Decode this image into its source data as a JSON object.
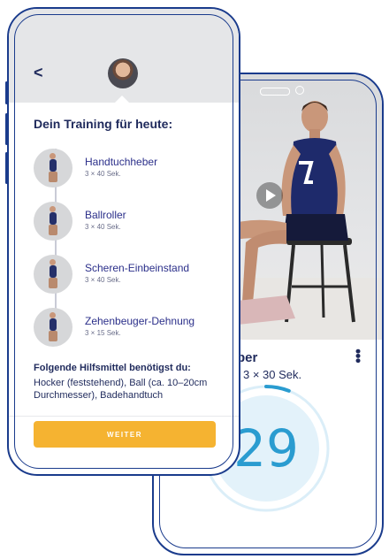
{
  "plan": {
    "title": "Dein Training für heute:",
    "exercises": [
      {
        "name": "Handtuchheber",
        "sets": "3 × 40 Sek."
      },
      {
        "name": "Ballroller",
        "sets": "3 × 40 Sek."
      },
      {
        "name": "Scheren-Einbeinstand",
        "sets": "3 × 40 Sek."
      },
      {
        "name": "Zehenbeuger-Dehnung",
        "sets": "3 × 15 Sek."
      }
    ],
    "aids_title": "Folgende Hilfsmittel benötigst du:",
    "aids_text": "Hocker (feststehend), Ball (ca. 10–20cm Durchmesser), Badehandtuch",
    "cta_label": "WEITER"
  },
  "player": {
    "exercise_title": "ber",
    "exercise_meta": "| 3 × 30 Sek.",
    "timer_value": "29",
    "timer_progress_percent": 6
  },
  "icons": {
    "back": "chevron-left-icon",
    "play": "play-icon",
    "more": "kebab-menu-icon"
  },
  "colors": {
    "accent": "#f5b331",
    "navy": "#1f2a5c",
    "timer": "#2a9cd0"
  }
}
